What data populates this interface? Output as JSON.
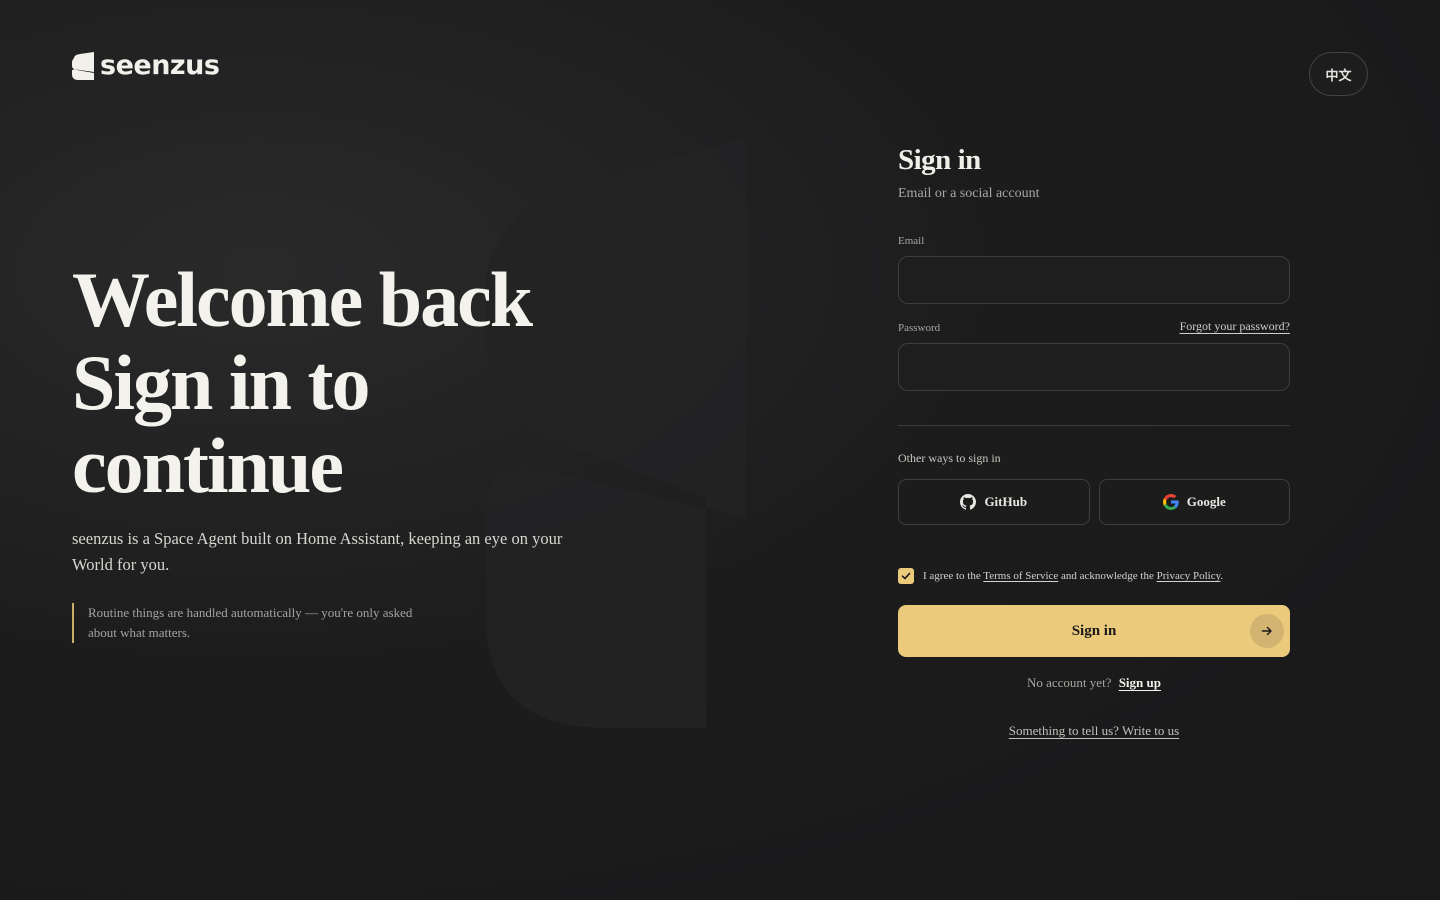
{
  "brand": {
    "name": "seenzus",
    "logo_icon": "seenzus-logo-icon"
  },
  "lang_toggle": {
    "label": "中文"
  },
  "hero": {
    "title_lines": [
      "Welcome back",
      "Sign in to",
      "continue"
    ],
    "description": "seenzus is a Space Agent built on Home Assistant, keeping an eye on your World for you.",
    "quote": "Routine things are handled automatically — you're only asked about what matters."
  },
  "form": {
    "title": "Sign in",
    "subtitle": "Email or a social account",
    "email_label": "Email",
    "email_value": "",
    "password_label": "Password",
    "password_value": "",
    "forgot_label": "Forgot your password?",
    "other_ways_label": "Other ways to sign in",
    "github_label": "GitHub",
    "google_label": "Google",
    "agree": {
      "checked": true,
      "prefix": "I agree to the",
      "terms": "Terms of Service",
      "middle": "and acknowledge the",
      "privacy": "Privacy Policy",
      "suffix": "."
    },
    "submit_label": "Sign in",
    "no_account": "No account yet?",
    "signup_label": "Sign up",
    "feedback_label": "Something to tell us? Write to us"
  },
  "colors": {
    "accent": "#ecca7c",
    "background": "#1c1c1d",
    "border": "#3e3e40"
  }
}
